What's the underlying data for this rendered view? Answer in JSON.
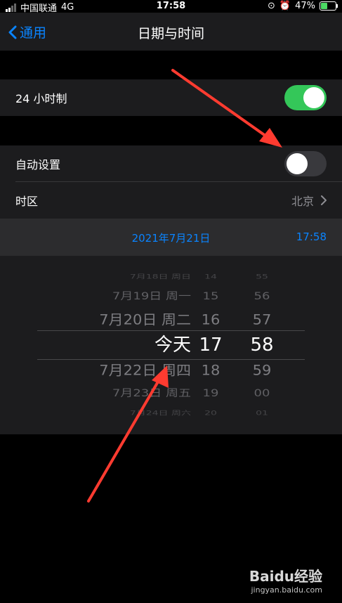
{
  "status_bar": {
    "carrier": "中国联通",
    "network": "4G",
    "time": "17:58",
    "battery_percent": "47%",
    "battery_level": 0.47
  },
  "nav": {
    "back_label": "通用",
    "title": "日期与时间"
  },
  "settings": {
    "hour24": {
      "label": "24 小时制",
      "on": true
    },
    "auto_set": {
      "label": "自动设置",
      "on": false
    },
    "timezone": {
      "label": "时区",
      "value": "北京"
    }
  },
  "current": {
    "date": "2021年7月21日",
    "time": "17:58"
  },
  "picker": {
    "rows": [
      {
        "date": "7月18日 周日",
        "hour": "14",
        "minute": "55"
      },
      {
        "date": "7月19日 周一",
        "hour": "15",
        "minute": "56"
      },
      {
        "date": "7月20日 周二",
        "hour": "16",
        "minute": "57"
      },
      {
        "date": "今天",
        "hour": "17",
        "minute": "58",
        "selected": true
      },
      {
        "date": "7月22日 周四",
        "hour": "18",
        "minute": "59"
      },
      {
        "date": "7月23日 周五",
        "hour": "19",
        "minute": "00"
      },
      {
        "date": "7月24日 周六",
        "hour": "20",
        "minute": "01"
      }
    ]
  },
  "watermark": {
    "brand": "Baidu经验",
    "url": "jingyan.baidu.com"
  },
  "colors": {
    "accent": "#0a84ff",
    "toggle_on": "#34c759",
    "arrow": "#ff3b30"
  }
}
